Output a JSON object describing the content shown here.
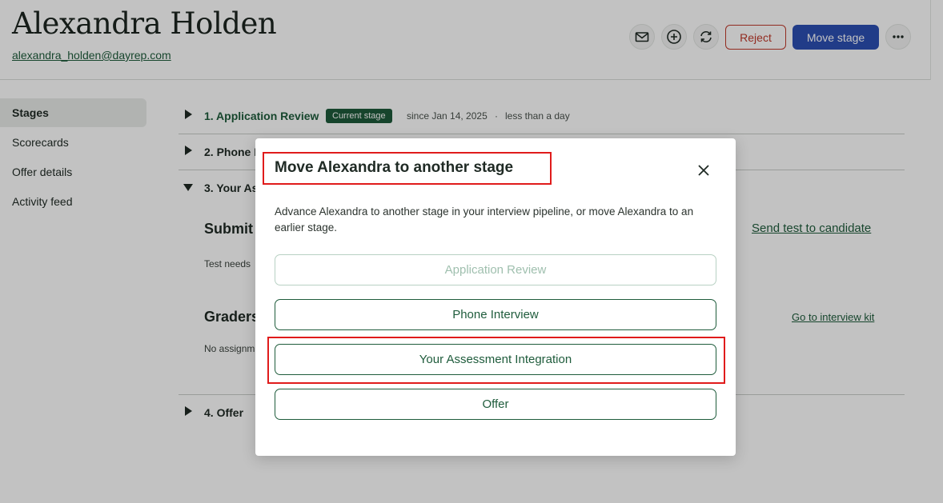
{
  "header": {
    "candidate_name": "Alexandra Holden",
    "candidate_email": "alexandra_holden@dayrep.com",
    "actions": {
      "email_icon": "envelope-icon",
      "add_icon": "plus-circle-icon",
      "sync_icon": "refresh-icon",
      "reject_label": "Reject",
      "move_stage_label": "Move stage",
      "more_icon": "ellipsis-icon"
    }
  },
  "sidebar": {
    "items": [
      {
        "label": "Stages",
        "active": true
      },
      {
        "label": "Scorecards"
      },
      {
        "label": "Offer details"
      },
      {
        "label": "Activity feed"
      }
    ]
  },
  "stages": {
    "stage1": {
      "title": "1. Application Review",
      "badge": "Current stage",
      "since": "since Jan 14, 2025",
      "separator": "·",
      "duration": "less than a day"
    },
    "stage2": {
      "title": "2. Phone I"
    },
    "stage3": {
      "title": "3. Your As"
    },
    "submit_heading": "Submit",
    "send_test_link": "Send test to candidate",
    "test_note": "Test needs",
    "graders_heading": "Graders",
    "go_to_kit_link": "Go to interview kit",
    "no_assign_note": "No assignm",
    "stage4": {
      "title": "4. Offer"
    }
  },
  "modal": {
    "title": "Move Alexandra to another stage",
    "close_icon": "close-icon",
    "description": "Advance Alexandra to another stage in your interview pipeline, or move Alexandra to an earlier stage.",
    "options": [
      {
        "label": "Application Review",
        "disabled": true
      },
      {
        "label": "Phone Interview"
      },
      {
        "label": "Your Assessment Integration",
        "highlighted": true
      },
      {
        "label": "Offer"
      }
    ]
  },
  "colors": {
    "brand_green": "#1f5c3c",
    "primary_blue": "#2c4fb3",
    "reject_red": "#c0392b",
    "annotation_red": "#e01b1b"
  }
}
